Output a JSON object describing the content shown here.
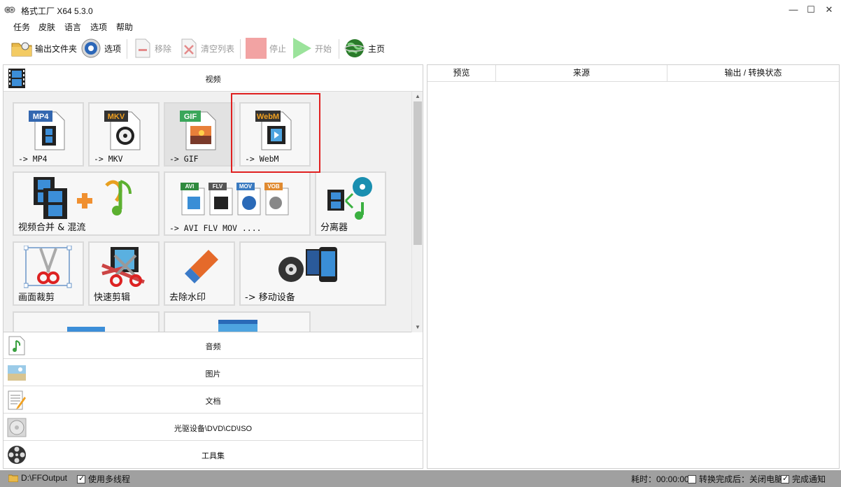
{
  "window": {
    "title": "格式工厂 X64 5.3.0",
    "minimize": "—",
    "maximize": "☐",
    "close": "✕"
  },
  "menu": [
    "任务",
    "皮肤",
    "语言",
    "选项",
    "帮助"
  ],
  "toolbar": {
    "output_folder": "输出文件夹",
    "options": "选项",
    "remove": "移除",
    "clear_list": "清空列表",
    "stop": "停止",
    "start": "开始",
    "home": "主页"
  },
  "categories": {
    "video": "视频",
    "audio": "音频",
    "image": "图片",
    "document": "文档",
    "optical": "光驱设备\\DVD\\CD\\ISO",
    "tools": "工具集"
  },
  "tiles": {
    "mp4": {
      "label": "-> MP4",
      "badge": "MP4"
    },
    "mkv": {
      "label": "-> MKV",
      "badge": "MKV"
    },
    "gif": {
      "label": "-> GIF",
      "badge": "GIF"
    },
    "webm": {
      "label": "-> WebM",
      "badge": "WebM"
    },
    "merge": {
      "label": "视频合并 & 混流"
    },
    "multi": {
      "label": "-> AVI FLV MOV ....",
      "badges": [
        "AVI",
        "FLV",
        "MOV",
        "VOB"
      ]
    },
    "splitter": {
      "label": "分离器"
    },
    "crop": {
      "label": "画面裁剪"
    },
    "quickcut": {
      "label": "快速剪辑"
    },
    "watermark": {
      "label": "去除水印"
    },
    "mobile": {
      "label": "-> 移动设备"
    }
  },
  "task_list": {
    "columns": [
      "预览",
      "来源",
      "输出 / 转换状态"
    ]
  },
  "statusbar": {
    "output_path": "D:\\FFOutput",
    "multithread": "使用多线程",
    "elapsed": "耗时：00:00:00",
    "after_convert": "转换完成后：关闭电脑",
    "notify": "完成通知",
    "multithread_checked": true,
    "after_convert_checked": false,
    "notify_checked": true
  },
  "colors": {
    "highlight": "#e02020",
    "statusbar": "#a0a0a0"
  }
}
